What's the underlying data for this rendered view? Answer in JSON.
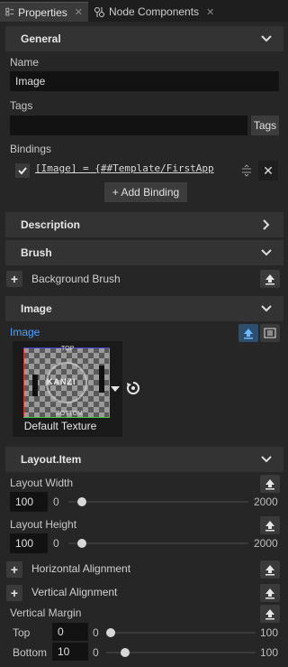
{
  "tabs": [
    {
      "label": "Properties",
      "active": true
    },
    {
      "label": "Node Components",
      "active": false
    }
  ],
  "sections": {
    "general": "General",
    "description": "Description",
    "brush": "Brush",
    "image": "Image",
    "layout_item": "Layout.Item"
  },
  "general": {
    "name_label": "Name",
    "name_value": "Image",
    "tags_label": "Tags",
    "tags_button": "Tags",
    "bindings_label": "Bindings",
    "binding_text": "[Image] = {##Template/FirstApp",
    "add_binding": "+ Add Binding"
  },
  "brush": {
    "background_brush": "Background Brush"
  },
  "image": {
    "image_label": "Image",
    "thumb_top": "TOP",
    "thumb_bottom": "BOTTOM",
    "thumb_logo": "KANZI",
    "texture_name": "Default Texture"
  },
  "layout": {
    "width_label": "Layout Width",
    "width_value": "100",
    "width_min": "0",
    "width_max": "2000",
    "width_fraction": 0.05,
    "height_label": "Layout Height",
    "height_value": "100",
    "height_min": "0",
    "height_max": "2000",
    "height_fraction": 0.05,
    "horizontal_alignment": "Horizontal Alignment",
    "vertical_alignment": "Vertical Alignment",
    "vertical_margin": "Vertical Margin",
    "top_label": "Top",
    "top_value": "0",
    "top_min": "0",
    "top_max": "100",
    "top_fraction": 0.0,
    "bottom_label": "Bottom",
    "bottom_value": "10",
    "bottom_min": "0",
    "bottom_max": "100",
    "bottom_fraction": 0.1
  },
  "colors": {
    "accent": "#4aa3ff",
    "background": "#262626",
    "section": "#333333"
  }
}
